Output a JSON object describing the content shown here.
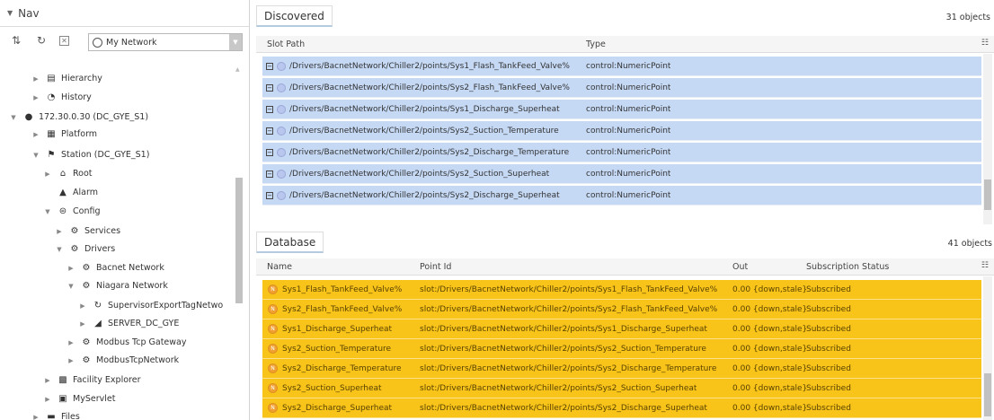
{
  "nav": {
    "title": "Nav",
    "network_select": "My Network",
    "tree": [
      {
        "label": "Hierarchy",
        "indent": 1,
        "icon": "hierarchy-icon",
        "twisty": "▶"
      },
      {
        "label": "History",
        "indent": 1,
        "icon": "history-icon",
        "twisty": "▶"
      },
      {
        "label": "172.30.0.30 (DC_GYE_S1)",
        "indent": 0,
        "icon": "host-icon",
        "twisty": "▼"
      },
      {
        "label": "Platform",
        "indent": 1,
        "icon": "platform-icon",
        "twisty": "▶"
      },
      {
        "label": "Station (DC_GYE_S1)",
        "indent": 1,
        "icon": "station-icon",
        "twisty": "▼"
      },
      {
        "label": "Root",
        "indent": 2,
        "icon": "root-icon",
        "twisty": "▶"
      },
      {
        "label": "Alarm",
        "indent": 2,
        "icon": "alarm-icon",
        "twisty": ""
      },
      {
        "label": "Config",
        "indent": 2,
        "icon": "config-icon",
        "twisty": "▼"
      },
      {
        "label": "Services",
        "indent": 3,
        "icon": "services-icon",
        "twisty": "▶"
      },
      {
        "label": "Drivers",
        "indent": 3,
        "icon": "drivers-icon",
        "twisty": "▼"
      },
      {
        "label": "Bacnet Network",
        "indent": 4,
        "icon": "network-icon",
        "twisty": "▶"
      },
      {
        "label": "Niagara Network",
        "indent": 4,
        "icon": "network-icon",
        "twisty": "▼"
      },
      {
        "label": "SupervisorExportTagNetwo",
        "indent": 5,
        "icon": "sync-icon",
        "twisty": "▶"
      },
      {
        "label": "SERVER_DC_GYE",
        "indent": 5,
        "icon": "server-icon",
        "twisty": "▶"
      },
      {
        "label": "Modbus Tcp Gateway",
        "indent": 4,
        "icon": "network-icon",
        "twisty": "▶"
      },
      {
        "label": "ModbusTcpNetwork",
        "indent": 4,
        "icon": "network-icon",
        "twisty": "▶"
      },
      {
        "label": "Facility Explorer",
        "indent": 2,
        "icon": "facility-icon",
        "twisty": "▶"
      },
      {
        "label": "MyServlet",
        "indent": 2,
        "icon": "servlet-icon",
        "twisty": "▶"
      },
      {
        "label": "Files",
        "indent": 1,
        "icon": "files-icon",
        "twisty": "▶"
      }
    ]
  },
  "discovered": {
    "title": "Discovered",
    "count": "31 objects",
    "columns": [
      "Slot Path",
      "Type"
    ],
    "rows": [
      {
        "slot": "/Drivers/BacnetNetwork/Chiller2/points/Sys1_Flash_TankFeed_Valve%",
        "type": "control:NumericPoint"
      },
      {
        "slot": "/Drivers/BacnetNetwork/Chiller2/points/Sys2_Flash_TankFeed_Valve%",
        "type": "control:NumericPoint"
      },
      {
        "slot": "/Drivers/BacnetNetwork/Chiller2/points/Sys1_Discharge_Superheat",
        "type": "control:NumericPoint"
      },
      {
        "slot": "/Drivers/BacnetNetwork/Chiller2/points/Sys2_Suction_Temperature",
        "type": "control:NumericPoint"
      },
      {
        "slot": "/Drivers/BacnetNetwork/Chiller2/points/Sys2_Discharge_Temperature",
        "type": "control:NumericPoint"
      },
      {
        "slot": "/Drivers/BacnetNetwork/Chiller2/points/Sys2_Suction_Superheat",
        "type": "control:NumericPoint"
      },
      {
        "slot": "/Drivers/BacnetNetwork/Chiller2/points/Sys2_Discharge_Superheat",
        "type": "control:NumericPoint"
      }
    ]
  },
  "database": {
    "title": "Database",
    "count": "41 objects",
    "columns": [
      "Name",
      "Point Id",
      "Out",
      "Subscription Status"
    ],
    "rows": [
      {
        "name": "Sys1_Flash_TankFeed_Valve%",
        "point": "slot:/Drivers/BacnetNetwork/Chiller2/points/Sys1_Flash_TankFeed_Valve%",
        "out": "0.00 {down,stale}",
        "status": "Subscribed"
      },
      {
        "name": "Sys2_Flash_TankFeed_Valve%",
        "point": "slot:/Drivers/BacnetNetwork/Chiller2/points/Sys2_Flash_TankFeed_Valve%",
        "out": "0.00 {down,stale}",
        "status": "Subscribed"
      },
      {
        "name": "Sys1_Discharge_Superheat",
        "point": "slot:/Drivers/BacnetNetwork/Chiller2/points/Sys1_Discharge_Superheat",
        "out": "0.00 {down,stale}",
        "status": "Subscribed"
      },
      {
        "name": "Sys2_Suction_Temperature",
        "point": "slot:/Drivers/BacnetNetwork/Chiller2/points/Sys2_Suction_Temperature",
        "out": "0.00 {down,stale}",
        "status": "Subscribed"
      },
      {
        "name": "Sys2_Discharge_Temperature",
        "point": "slot:/Drivers/BacnetNetwork/Chiller2/points/Sys2_Discharge_Temperature",
        "out": "0.00 {down,stale}",
        "status": "Subscribed"
      },
      {
        "name": "Sys2_Suction_Superheat",
        "point": "slot:/Drivers/BacnetNetwork/Chiller2/points/Sys2_Suction_Superheat",
        "out": "0.00 {down,stale}",
        "status": "Subscribed"
      },
      {
        "name": "Sys2_Discharge_Superheat",
        "point": "slot:/Drivers/BacnetNetwork/Chiller2/points/Sys2_Discharge_Superheat",
        "out": "0.00 {down,stale}",
        "status": "Subscribed"
      }
    ]
  },
  "colors": {
    "discovered_row": "#c5d9f5",
    "database_row": "#f8c41a"
  }
}
